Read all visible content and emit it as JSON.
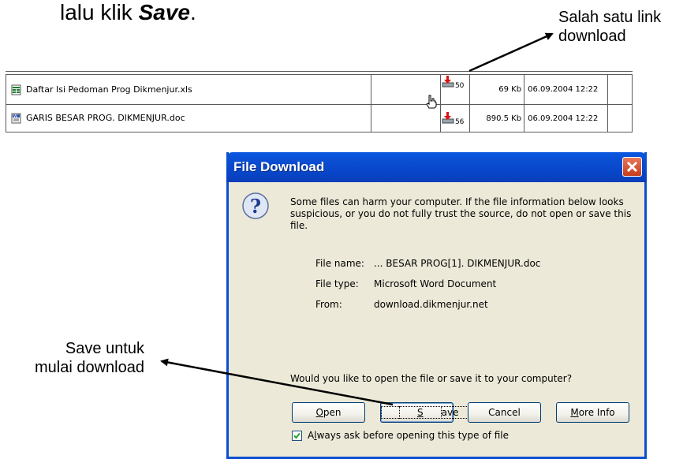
{
  "headline": {
    "prefix": "lalu klik ",
    "emphasis": "Save",
    "suffix": "."
  },
  "annotations": {
    "link_line1": "Salah satu link",
    "link_line2": "download",
    "save_line1": "Save untuk",
    "save_line2": "mulai download"
  },
  "files": [
    {
      "name": "Daftar Isi Pedoman Prog Dikmenjur.xls",
      "icon": "excel-file-icon",
      "download_count": "50",
      "size": "69 Kb",
      "date": "06.09.2004 12:22"
    },
    {
      "name": "GARIS BESAR PROG. DIKMENJUR.doc",
      "icon": "word-file-icon",
      "download_count": "56",
      "size": "890.5 Kb",
      "date": "06.09.2004 12:22"
    }
  ],
  "dialog": {
    "title": "File Download",
    "warning": "Some files can harm your computer. If the file information below looks suspicious, or you do not fully trust the source, do not open or save this file.",
    "info": {
      "file_name_label": "File name:",
      "file_name": "... BESAR PROG[1]. DIKMENJUR.doc",
      "file_type_label": "File type:",
      "file_type": "Microsoft Word Document",
      "from_label": "From:",
      "from": "download.dikmenjur.net"
    },
    "question": "Would you like to open the file or save it to your computer?",
    "buttons": {
      "open": "Open",
      "save": "Save",
      "cancel": "Cancel",
      "more_info": "More Info"
    },
    "checkbox_label": "Always ask before opening this type of file",
    "checkbox_checked": true
  },
  "colors": {
    "titlebar": "#0a4fcf",
    "dialog_bg": "#ece9d8",
    "close_button": "#d4512e"
  }
}
